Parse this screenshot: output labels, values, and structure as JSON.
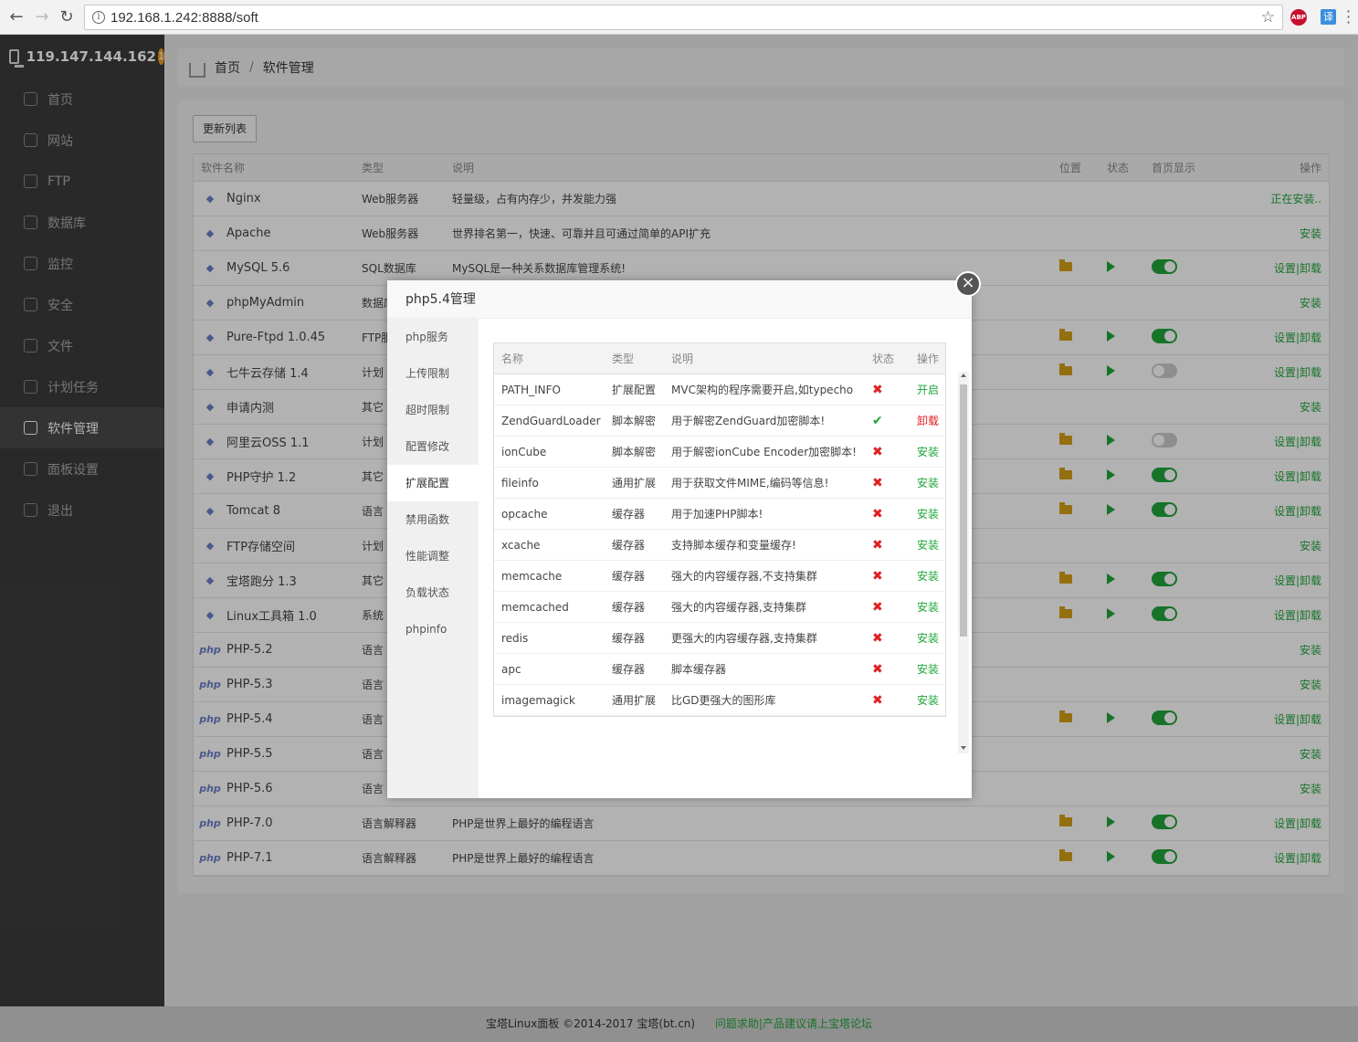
{
  "browser": {
    "url": "192.168.1.242:8888/soft",
    "ext_abp": "ABP",
    "ext_translate": "译"
  },
  "sidebar": {
    "host": "119.147.144.162",
    "badge": "1",
    "items": [
      {
        "label": "首页",
        "icon": "home-icon"
      },
      {
        "label": "网站",
        "icon": "globe-icon"
      },
      {
        "label": "FTP",
        "icon": "ftp-icon"
      },
      {
        "label": "数据库",
        "icon": "database-icon"
      },
      {
        "label": "监控",
        "icon": "monitor-icon"
      },
      {
        "label": "安全",
        "icon": "shield-icon"
      },
      {
        "label": "文件",
        "icon": "folder-icon"
      },
      {
        "label": "计划任务",
        "icon": "calendar-icon"
      },
      {
        "label": "软件管理",
        "icon": "grid-icon",
        "active": true
      },
      {
        "label": "面板设置",
        "icon": "gear-icon"
      },
      {
        "label": "退出",
        "icon": "logout-icon"
      }
    ]
  },
  "breadcrumb": {
    "home": "首页",
    "sep": "/",
    "current": "软件管理"
  },
  "panel": {
    "update_button": "更新列表",
    "headers": {
      "name": "软件名称",
      "type": "类型",
      "desc": "说明",
      "loc": "位置",
      "stat": "状态",
      "home": "首页显示",
      "op": "操作"
    },
    "rows": [
      {
        "name": "Nginx",
        "type": "Web服务器",
        "desc": "轻量级，占有内存少，并发能力强",
        "op": "正在安装..",
        "loc": false,
        "toggle": null
      },
      {
        "name": "Apache",
        "type": "Web服务器",
        "desc": "世界排名第一，快速、可靠并且可通过简单的API扩充",
        "op": "安装",
        "loc": false,
        "toggle": null
      },
      {
        "name": "MySQL 5.6",
        "type": "SQL数据库",
        "desc": "MySQL是一种关系数据库管理系统!",
        "op": "设置|卸载",
        "loc": true,
        "toggle": "on"
      },
      {
        "name": "phpMyAdmin",
        "type": "数据库",
        "desc": "",
        "op": "安装",
        "loc": false,
        "toggle": null
      },
      {
        "name": "Pure-Ftpd 1.0.45",
        "type": "FTP服",
        "desc": "",
        "op": "设置|卸载",
        "loc": true,
        "toggle": "on"
      },
      {
        "name": "七牛云存储 1.4",
        "type": "计划",
        "desc": "",
        "op": "设置|卸载",
        "loc": true,
        "toggle": "off"
      },
      {
        "name": "申请内测",
        "type": "其它",
        "desc": "",
        "op": "安装",
        "loc": false,
        "toggle": null
      },
      {
        "name": "阿里云OSS 1.1",
        "type": "计划",
        "desc": "",
        "op": "设置|卸载",
        "loc": true,
        "toggle": "off"
      },
      {
        "name": "PHP守护 1.2",
        "type": "其它",
        "desc": "",
        "op": "设置|卸载",
        "loc": true,
        "toggle": "on"
      },
      {
        "name": "Tomcat 8",
        "type": "语言",
        "desc": "",
        "op": "设置|卸载",
        "loc": true,
        "toggle": "on"
      },
      {
        "name": "FTP存储空间",
        "type": "计划",
        "desc": "",
        "op": "安装",
        "loc": false,
        "toggle": null
      },
      {
        "name": "宝塔跑分 1.3",
        "type": "其它",
        "desc": "",
        "op": "设置|卸载",
        "loc": true,
        "toggle": "on"
      },
      {
        "name": "Linux工具箱 1.0",
        "type": "系统",
        "desc": "",
        "op": "设置|卸载",
        "loc": true,
        "toggle": "on"
      },
      {
        "name": "PHP-5.2",
        "type": "语言",
        "desc": "",
        "op": "安装",
        "loc": false,
        "toggle": null
      },
      {
        "name": "PHP-5.3",
        "type": "语言",
        "desc": "",
        "op": "安装",
        "loc": false,
        "toggle": null
      },
      {
        "name": "PHP-5.4",
        "type": "语言",
        "desc": "",
        "op": "设置|卸载",
        "loc": true,
        "toggle": "on"
      },
      {
        "name": "PHP-5.5",
        "type": "语言",
        "desc": "",
        "op": "安装",
        "loc": false,
        "toggle": null
      },
      {
        "name": "PHP-5.6",
        "type": "语言",
        "desc": "",
        "op": "安装",
        "loc": false,
        "toggle": null
      },
      {
        "name": "PHP-7.0",
        "type": "语言解释器",
        "desc": "PHP是世界上最好的编程语言",
        "op": "设置|卸载",
        "loc": true,
        "toggle": "on"
      },
      {
        "name": "PHP-7.1",
        "type": "语言解释器",
        "desc": "PHP是世界上最好的编程语言",
        "op": "设置|卸载",
        "loc": true,
        "toggle": "on"
      }
    ]
  },
  "modal": {
    "title": "php5.4管理",
    "close": "×",
    "menu": [
      {
        "label": "php服务"
      },
      {
        "label": "上传限制"
      },
      {
        "label": "超时限制"
      },
      {
        "label": "配置修改"
      },
      {
        "label": "扩展配置",
        "active": true
      },
      {
        "label": "禁用函数"
      },
      {
        "label": "性能调整"
      },
      {
        "label": "负载状态"
      },
      {
        "label": "phpinfo"
      }
    ],
    "headers": {
      "name": "名称",
      "type": "类型",
      "desc": "说明",
      "stat": "状态",
      "op": "操作"
    },
    "rows": [
      {
        "name": "PATH_INFO",
        "type": "扩展配置",
        "desc": "MVC架构的程序需要开启,如typecho",
        "stat": "off",
        "op": "开启",
        "op_color": "green"
      },
      {
        "name": "ZendGuardLoader",
        "type": "脚本解密",
        "desc": "用于解密ZendGuard加密脚本!",
        "stat": "on",
        "op": "卸载",
        "op_color": "red"
      },
      {
        "name": "ionCube",
        "type": "脚本解密",
        "desc": "用于解密ionCube Encoder加密脚本!",
        "stat": "off",
        "op": "安装",
        "op_color": "green"
      },
      {
        "name": "fileinfo",
        "type": "通用扩展",
        "desc": "用于获取文件MIME,编码等信息!",
        "stat": "off",
        "op": "安装",
        "op_color": "green"
      },
      {
        "name": "opcache",
        "type": "缓存器",
        "desc": "用于加速PHP脚本!",
        "stat": "off",
        "op": "安装",
        "op_color": "green"
      },
      {
        "name": "xcache",
        "type": "缓存器",
        "desc": "支持脚本缓存和变量缓存!",
        "stat": "off",
        "op": "安装",
        "op_color": "green"
      },
      {
        "name": "memcache",
        "type": "缓存器",
        "desc": "强大的内容缓存器,不支持集群",
        "stat": "off",
        "op": "安装",
        "op_color": "green"
      },
      {
        "name": "memcached",
        "type": "缓存器",
        "desc": "强大的内容缓存器,支持集群",
        "stat": "off",
        "op": "安装",
        "op_color": "green"
      },
      {
        "name": "redis",
        "type": "缓存器",
        "desc": "更强大的内容缓存器,支持集群",
        "stat": "off",
        "op": "安装",
        "op_color": "green"
      },
      {
        "name": "apc",
        "type": "缓存器",
        "desc": "脚本缓存器",
        "stat": "off",
        "op": "安装",
        "op_color": "green"
      },
      {
        "name": "imagemagick",
        "type": "通用扩展",
        "desc": "比GD更强大的图形库",
        "stat": "off",
        "op": "安装",
        "op_color": "green"
      }
    ]
  },
  "footer": {
    "copyright": "宝塔Linux面板 ©2014-2017 宝塔(bt.cn)",
    "link": "问题求助|产品建议请上宝塔论坛"
  },
  "colors": {
    "accent": "#20a53a",
    "danger": "#e02020",
    "sidebar_bg": "#3c3c3c"
  }
}
